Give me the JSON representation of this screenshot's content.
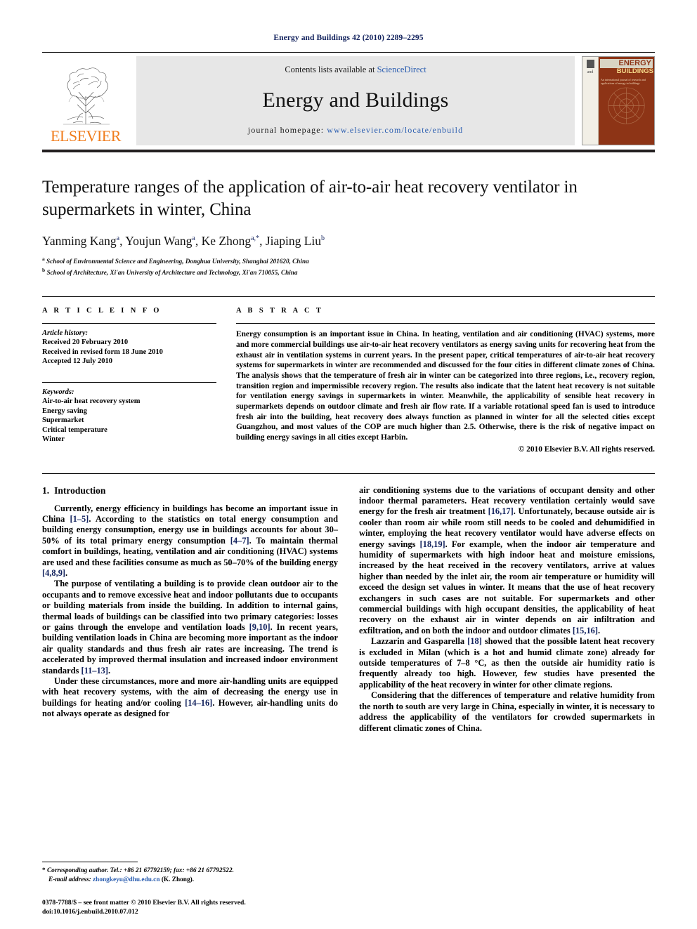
{
  "running_head": "Energy and Buildings 42 (2010) 2289–2295",
  "banner": {
    "publisher_name": "ELSEVIER",
    "contents_prefix": "Contents lists available at ",
    "contents_link": "ScienceDirect",
    "journal_title": "Energy and Buildings",
    "homepage_prefix": "journal homepage:",
    "homepage_url": "www.elsevier.com/locate/enbuild",
    "cover": {
      "and_label": "and",
      "energy_label": "ENERGY",
      "buildings_label": "BUILDINGS",
      "subtitle": "An international journal of research and applications of energy in buildings"
    }
  },
  "article": {
    "title": "Temperature ranges of the application of air-to-air heat recovery ventilator in supermarkets in winter, China",
    "authors_html": "Yanming Kang<sup>a</sup>, Youjun Wang<sup>a</sup>, Ke Zhong<sup>a,*</sup>, Jiaping Liu<sup>b</sup>",
    "affiliation_a": "School of Environmental Science and Engineering, Donghua University, Shanghai 201620, China",
    "affiliation_b": "School of Architecture, Xi'an University of Architecture and Technology, Xi'an 710055, China"
  },
  "article_info": {
    "heading": "A R T I C L E    I N F O",
    "history_label": "Article history:",
    "history": [
      "Received 20 February 2010",
      "Received in revised form 18 June 2010",
      "Accepted 12 July 2010"
    ],
    "keywords_label": "Keywords:",
    "keywords": [
      "Air-to-air heat recovery system",
      "Energy saving",
      "Supermarket",
      "Critical temperature",
      "Winter"
    ]
  },
  "abstract": {
    "heading": "A B S T R A C T",
    "text": "Energy consumption is an important issue in China. In heating, ventilation and air conditioning (HVAC) systems, more and more commercial buildings use air-to-air heat recovery ventilators as energy saving units for recovering heat from the exhaust air in ventilation systems in current years. In the present paper, critical temperatures of air-to-air heat recovery systems for supermarkets in winter are recommended and discussed for the four cities in different climate zones of China. The analysis shows that the temperature of fresh air in winter can be categorized into three regions, i.e., recovery region, transition region and impermissible recovery region. The results also indicate that the latent heat recovery is not suitable for ventilation energy savings in supermarkets in winter. Meanwhile, the applicability of sensible heat recovery in supermarkets depends on outdoor climate and fresh air flow rate. If a variable rotational speed fan is used to introduce fresh air into the building, heat recovery does always function as planned in winter for all the selected cities except Guangzhou, and most values of the COP are much higher than 2.5. Otherwise, there is the risk of negative impact on building energy savings in all cities except Harbin.",
    "copyright": "© 2010 Elsevier B.V. All rights reserved."
  },
  "section": {
    "number": "1.",
    "title": "Introduction"
  },
  "left_column_paragraphs": [
    {
      "parts": [
        {
          "t": "Currently, energy efficiency in buildings has become an important issue in China "
        },
        {
          "t": "[1–5]",
          "cite": true
        },
        {
          "t": ". According to the statistics on total energy consumption and building energy consumption, energy use in buildings accounts for about 30–50% of its total primary energy consumption "
        },
        {
          "t": "[4–7]",
          "cite": true
        },
        {
          "t": ". To maintain thermal comfort in buildings, heating, ventilation and air conditioning (HVAC) systems are used and these facilities consume as much as 50–70% of the building energy "
        },
        {
          "t": "[4,8,9]",
          "cite": true
        },
        {
          "t": "."
        }
      ]
    },
    {
      "parts": [
        {
          "t": "The purpose of ventilating a building is to provide clean outdoor air to the occupants and to remove excessive heat and indoor pollutants due to occupants or building materials from inside the building. In addition to internal gains, thermal loads of buildings can be classified into two primary categories: losses or gains through the envelope and ventilation loads "
        },
        {
          "t": "[9,10]",
          "cite": true
        },
        {
          "t": ". In recent years, building ventilation loads in China are becoming more important as the indoor air quality standards and thus fresh air rates are increasing. The trend is accelerated by improved thermal insulation and increased indoor environment standards "
        },
        {
          "t": "[11–13]",
          "cite": true
        },
        {
          "t": "."
        }
      ]
    },
    {
      "parts": [
        {
          "t": "Under these circumstances, more and more air-handling units are equipped with heat recovery systems, with the aim of decreasing the energy use in buildings for heating and/or cooling "
        },
        {
          "t": "[14–16]",
          "cite": true
        },
        {
          "t": ". However, air-handling units do not always operate as designed for"
        }
      ]
    }
  ],
  "right_column_paragraphs": [
    {
      "no_indent": true,
      "parts": [
        {
          "t": "air conditioning systems due to the variations of occupant density and other indoor thermal parameters. Heat recovery ventilation certainly would save energy for the fresh air treatment "
        },
        {
          "t": "[16,17]",
          "cite": true
        },
        {
          "t": ". Unfortunately, because outside air is cooler than room air while room still needs to be cooled and dehumidified in winter, employing the heat recovery ventilator would have adverse effects on energy savings "
        },
        {
          "t": "[18,19]",
          "cite": true
        },
        {
          "t": ". For example, when the indoor air temperature and humidity of supermarkets with high indoor heat and moisture emissions, increased by the heat received in the recovery ventilators, arrive at values higher than needed by the inlet air, the room air temperature or humidity will exceed the design set values in winter. It means that the use of heat recovery exchangers in such cases are not suitable. For supermarkets and other commercial buildings with high occupant densities, the applicability of heat recovery on the exhaust air in winter depends on air infiltration and exfiltration, and on both the indoor and outdoor climates "
        },
        {
          "t": "[15,16]",
          "cite": true
        },
        {
          "t": "."
        }
      ]
    },
    {
      "parts": [
        {
          "t": "Lazzarin and Gasparella "
        },
        {
          "t": "[18]",
          "cite": true
        },
        {
          "t": " showed that the possible latent heat recovery is excluded in Milan (which is a hot and humid climate zone) already for outside temperatures of 7–8 °C, as then the outside air humidity ratio is frequently already too high. However, few studies have presented the applicability of the heat recovery in winter for other climate regions."
        }
      ]
    },
    {
      "parts": [
        {
          "t": "Considering that the differences of temperature and relative humidity from the north to south are very large in China, especially in winter, it is necessary to address the applicability of the ventilators for crowded supermarkets in different climatic zones of China."
        }
      ]
    }
  ],
  "footnote": {
    "marker": "*",
    "corresponding": "Corresponding author. Tel.: +86 21 67792159; fax: +86 21 67792522.",
    "email_label": "E-mail address:",
    "email": "zhongkeyu@dhu.edu.cn",
    "email_suffix": "(K. Zhong)."
  },
  "imprint": {
    "line1": "0378-7788/$ – see front matter © 2010 Elsevier B.V. All rights reserved.",
    "line2": "doi:10.1016/j.enbuild.2010.07.012"
  }
}
